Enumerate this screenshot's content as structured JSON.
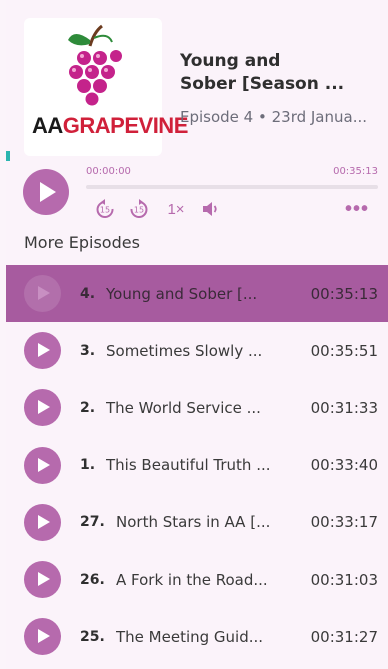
{
  "podcast": {
    "logo_aa": "AA",
    "logo_grapevine": "GRAPEVINE",
    "title_line1": "Young and",
    "title_line2": "Sober [Season ...",
    "subtitle": "Episode 4 • 23rd Janua..."
  },
  "player": {
    "current_time": "00:00:00",
    "total_time": "00:35:13",
    "progress": 0,
    "speed": "1×",
    "skip_back_seconds": "15",
    "skip_forward_seconds": "15",
    "more_label": "•••"
  },
  "more_episodes": {
    "heading": "More Episodes",
    "items": [
      {
        "number": "4.",
        "title": "Young and Sober [...",
        "duration": "00:35:13",
        "active": true
      },
      {
        "number": "3.",
        "title": "Sometimes Slowly ...",
        "duration": "00:35:51",
        "active": false
      },
      {
        "number": "2.",
        "title": "The World Service ...",
        "duration": "00:31:33",
        "active": false
      },
      {
        "number": "1.",
        "title": "This Beautiful Truth ...",
        "duration": "00:33:40",
        "active": false
      },
      {
        "number": "27.",
        "title": "North Stars in AA [...",
        "duration": "00:33:17",
        "active": false
      },
      {
        "number": "26.",
        "title": "A Fork in the Road...",
        "duration": "00:31:03",
        "active": false
      },
      {
        "number": "25.",
        "title": "The Meeting Guid...",
        "duration": "00:31:27",
        "active": false
      }
    ]
  },
  "colors": {
    "accent": "#b66aad",
    "active_row": "#a75b9f",
    "background": "#fbf3fa",
    "logo_red": "#d0203a",
    "leaf_green": "#2e8b3a"
  }
}
